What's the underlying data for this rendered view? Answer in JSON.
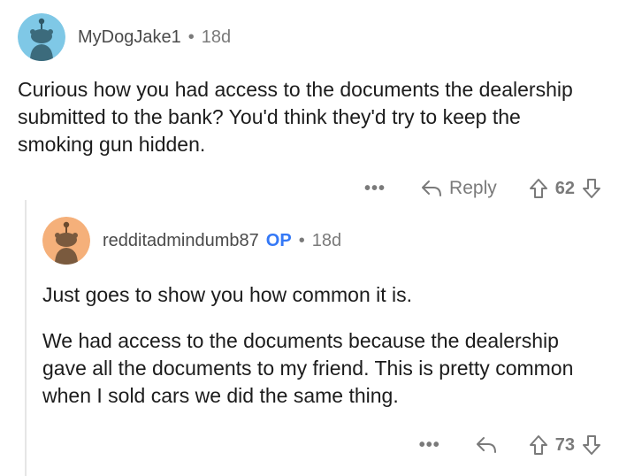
{
  "comment1": {
    "username": "MyDogJake1",
    "separator": "•",
    "age": "18d",
    "avatar_icon": "reddit-snoo-avatar",
    "avatar_color": "#7fc8e6",
    "body": "Curious how you had access to the documents the dealership submitted to the bank? You'd think they'd try to keep the smoking gun hidden.",
    "more_label": "•••",
    "reply_label": "Reply",
    "score": "62"
  },
  "comment2": {
    "username": "redditadmindumb87",
    "op_badge": "OP",
    "separator": "•",
    "age": "18d",
    "avatar_icon": "reddit-snoo-avatar",
    "avatar_color": "#f5b07a",
    "paragraphs": [
      "Just goes to show you how common it is.",
      "We had access to the documents because the dealership gave all the documents to my friend. This is pretty common when I sold cars we did the same thing."
    ],
    "more_label": "•••",
    "score": "73"
  },
  "colors": {
    "op_badge": "#3478f6",
    "meta_text": "#7a7a7a",
    "thread_line": "#e6e6e6"
  }
}
